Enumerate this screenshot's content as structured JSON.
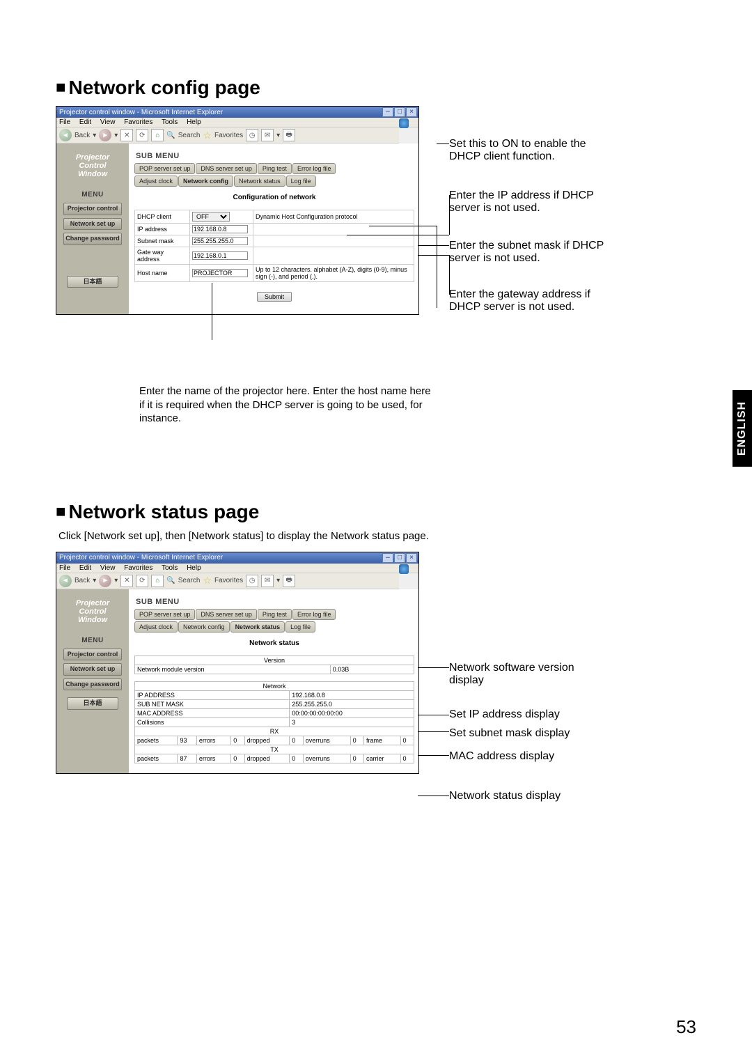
{
  "sections": {
    "config": {
      "title": "Network config page",
      "browser": {
        "window_title": "Projector control window - Microsoft Internet Explorer",
        "menubar": [
          "File",
          "Edit",
          "View",
          "Favorites",
          "Tools",
          "Help"
        ],
        "toolbar": {
          "back": "Back",
          "search": "Search",
          "favorites": "Favorites"
        }
      },
      "sidebar": {
        "logo_l1": "Projector",
        "logo_l2": "Control",
        "logo_l3": "Window",
        "menu_header": "MENU",
        "items": {
          "projector_control": "Projector control",
          "network_setup": "Network set up",
          "change_password": "Change password"
        },
        "lang": "日本語"
      },
      "submenu": {
        "header": "SUB MENU",
        "tabs_top": [
          "POP server set up",
          "DNS server set up",
          "Ping test",
          "Error log file"
        ],
        "tabs_bottom": [
          "Adjust clock",
          "Network config",
          "Network status",
          "Log file"
        ]
      },
      "panel": {
        "title": "Configuration of network",
        "rows": {
          "dhcp": {
            "label": "DHCP client",
            "value": "OFF",
            "desc": "Dynamic Host Configuration protocol"
          },
          "ip": {
            "label": "IP address",
            "value": "192.168.0.8",
            "desc": ""
          },
          "subnet": {
            "label": "Subnet mask",
            "value": "255.255.255.0",
            "desc": ""
          },
          "gateway": {
            "label": "Gate way address",
            "value": "192.168.0.1",
            "desc": ""
          },
          "host": {
            "label": "Host name",
            "value": "PROJECTOR",
            "desc": "Up to 12 characters. alphabet (A-Z), digits (0-9), minus sign (-), and period (.)."
          }
        },
        "submit": "Submit"
      },
      "annotations": {
        "dhcp_on": "Set this to ON to enable the DHCP client function.",
        "ip_addr": "Enter the IP address if DHCP server is not used.",
        "subnet": "Enter the subnet mask if DHCP server is not used.",
        "gateway": "Enter the gateway address if DHCP server is not used.",
        "hostname": "Enter the name of the projector here. Enter the host name here if it is required when the DHCP server is going to be used, for instance."
      }
    },
    "status": {
      "title": "Network status page",
      "intro": "Click [Network set up], then [Network status] to display the Network status page.",
      "browser": {
        "window_title": "Projector control window - Microsoft Internet Explorer",
        "menubar": [
          "File",
          "Edit",
          "View",
          "Favorites",
          "Tools",
          "Help"
        ],
        "toolbar": {
          "back": "Back",
          "search": "Search",
          "favorites": "Favorites"
        }
      },
      "sidebar": {
        "logo_l1": "Projector",
        "logo_l2": "Control",
        "logo_l3": "Window",
        "menu_header": "MENU",
        "items": {
          "projector_control": "Projector control",
          "network_setup": "Network set up",
          "change_password": "Change password"
        },
        "lang": "日本語"
      },
      "submenu": {
        "header": "SUB MENU",
        "tabs_top": [
          "POP server set up",
          "DNS server set up",
          "Ping test",
          "Error log file"
        ],
        "tabs_bottom": [
          "Adjust clock",
          "Network config",
          "Network status",
          "Log file"
        ]
      },
      "panel": {
        "title": "Network status",
        "version_header": "Version",
        "version_label": "Network module version",
        "version_value": "0.03B",
        "network_header": "Network",
        "ip_label": "IP ADDRESS",
        "ip_value": "192.168.0.8",
        "subnet_label": "SUB NET MASK",
        "subnet_value": "255.255.255.0",
        "mac_label": "MAC ADDRESS",
        "mac_value": "00:00:00:00:00:00",
        "collisions_label": "Collisions",
        "collisions_value": "3",
        "rx_header": "RX",
        "rx": {
          "packets_l": "packets",
          "packets": "93",
          "errors_l": "errors",
          "errors": "0",
          "dropped_l": "dropped",
          "dropped": "0",
          "overruns_l": "overruns",
          "overruns": "0",
          "frame_l": "frame",
          "frame": "0"
        },
        "tx_header": "TX",
        "tx": {
          "packets_l": "packets",
          "packets": "87",
          "errors_l": "errors",
          "errors": "0",
          "dropped_l": "dropped",
          "dropped": "0",
          "overruns_l": "overruns",
          "overruns": "0",
          "carrier_l": "carrier",
          "carrier": "0"
        }
      },
      "annotations": {
        "version": "Network software version display",
        "ip": "Set IP address display",
        "subnet": "Set subnet mask display",
        "mac": "MAC address display",
        "status": "Network status display"
      }
    }
  },
  "side_tab": "ENGLISH",
  "page_number": "53"
}
